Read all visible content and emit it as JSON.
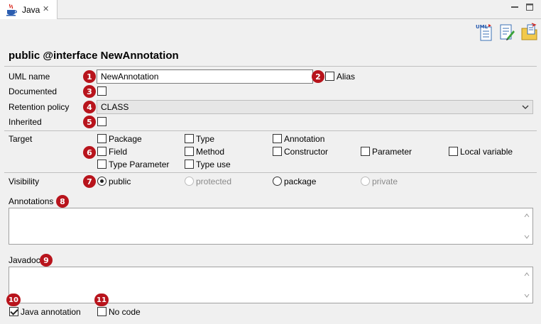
{
  "tab": {
    "label": "Java",
    "close_glyph": "✕"
  },
  "title": "public @interface NewAnnotation",
  "fields": {
    "uml_name_label": "UML name",
    "uml_name_value": "NewAnnotation",
    "alias_label": "Alias",
    "documented_label": "Documented",
    "retention_label": "Retention policy",
    "retention_value": "CLASS",
    "inherited_label": "Inherited"
  },
  "target": {
    "label": "Target",
    "options": {
      "package": "Package",
      "type": "Type",
      "annotation": "Annotation",
      "field": "Field",
      "method": "Method",
      "constructor": "Constructor",
      "parameter": "Parameter",
      "local_variable": "Local variable",
      "type_parameter": "Type Parameter",
      "type_use": "Type use"
    }
  },
  "visibility": {
    "label": "Visibility",
    "public": "public",
    "protected": "protected",
    "package": "package",
    "private": "private",
    "selected": "public"
  },
  "annotations_label": "Annotations",
  "javadoc_label": "Javadoc",
  "footer": {
    "java_annotation_label": "Java annotation",
    "java_annotation_checked": true,
    "no_code_label": "No code",
    "no_code_checked": false
  },
  "badges": [
    "1",
    "2",
    "3",
    "4",
    "5",
    "6",
    "7",
    "8",
    "9",
    "10",
    "11"
  ],
  "colors": {
    "badge": "#b8141c",
    "background": "#f0f0f0"
  },
  "toolbar_icons": [
    "uml-document-icon",
    "edit-document-icon",
    "folder-documents-icon"
  ]
}
